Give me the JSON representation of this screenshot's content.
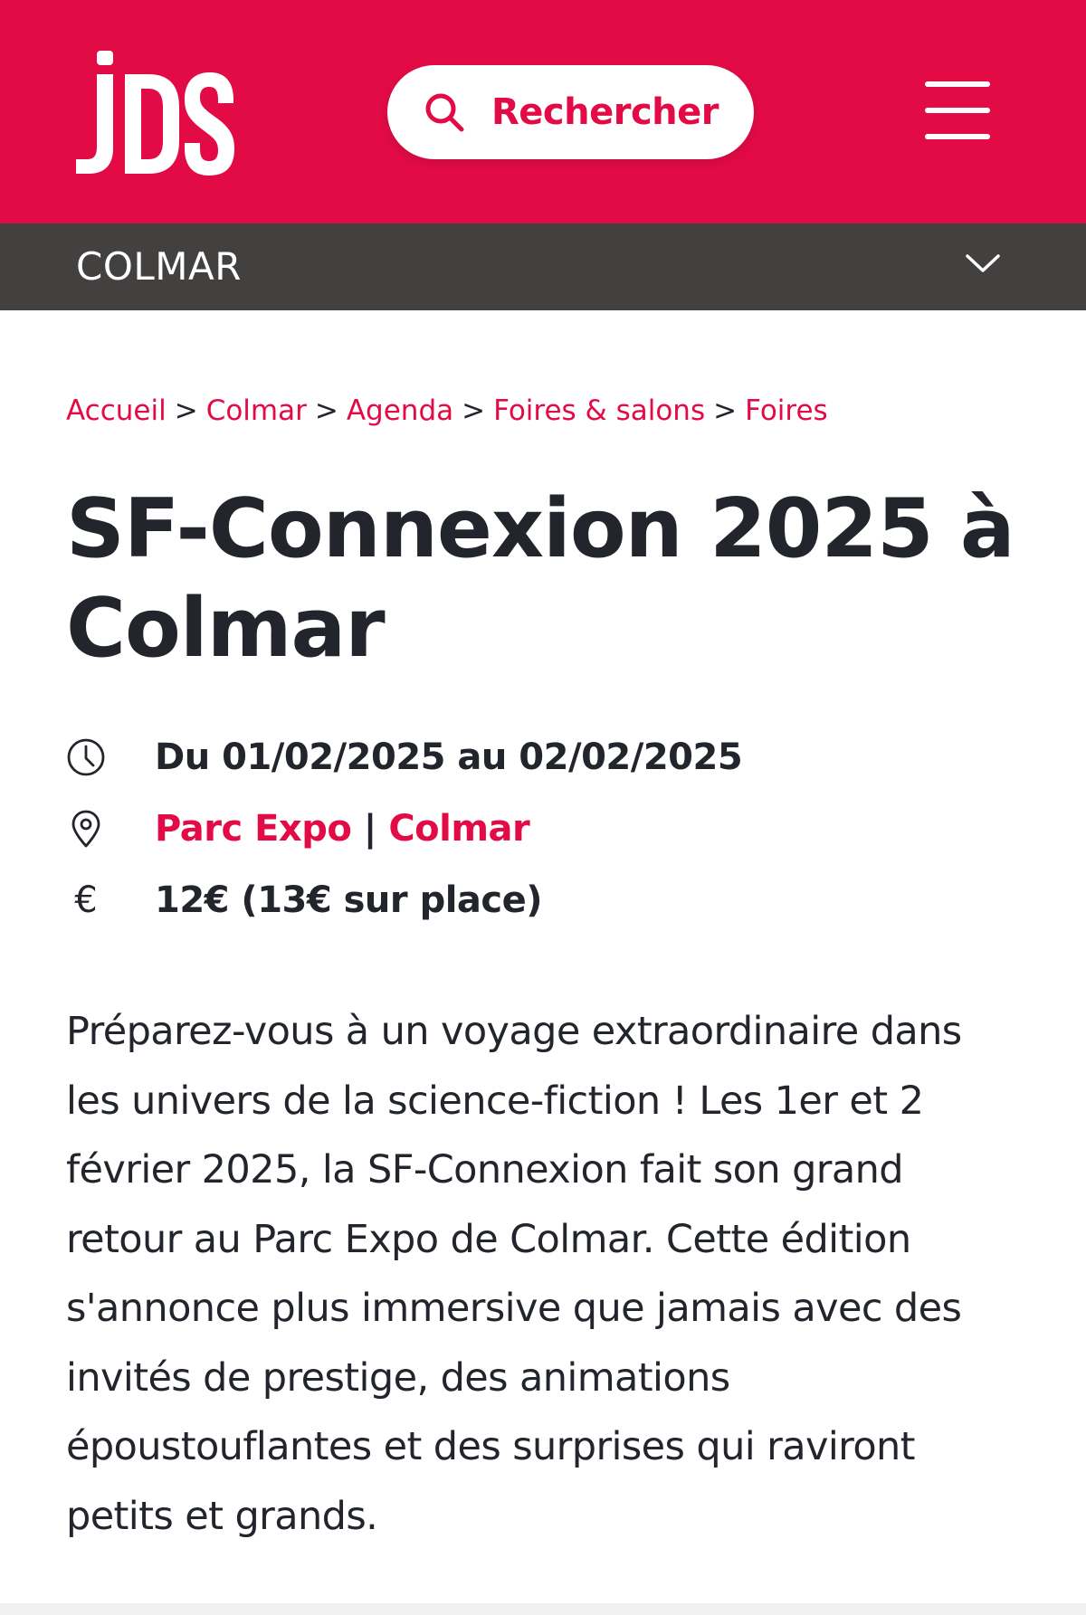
{
  "header": {
    "logo_text": "JDS",
    "search_label": "Rechercher",
    "brand_color": "#e30b45"
  },
  "city_bar": {
    "city": "COLMAR",
    "background_color": "#434040"
  },
  "breadcrumb": {
    "items": [
      "Accueil",
      "Colmar",
      "Agenda",
      "Foires & salons",
      "Foires"
    ],
    "separator": ">"
  },
  "event": {
    "title": "SF-Connexion 2025 à Colmar",
    "dates": "Du 01/02/2025 au 02/02/2025",
    "venue": "Parc Expo",
    "venue_separator": "|",
    "city": "Colmar",
    "price_symbol": "€",
    "price": "12€ (13€ sur place)",
    "description": "Préparez-vous à un voyage extraordinaire dans les univers de la science-fiction ! Les 1er et 2 février 2025, la SF-Connexion fait son grand retour au Parc Expo de Colmar. Cette édition s'annonce plus immersive que jamais avec des invités de prestige, des animations époustouflantes et des surprises qui raviront petits et grands."
  },
  "icons": {
    "search": "search-icon",
    "menu": "hamburger-menu-icon",
    "city_dropdown": "chevron-down-icon",
    "dates": "clock-icon",
    "venue": "map-pin-icon",
    "price": "euro-icon"
  }
}
